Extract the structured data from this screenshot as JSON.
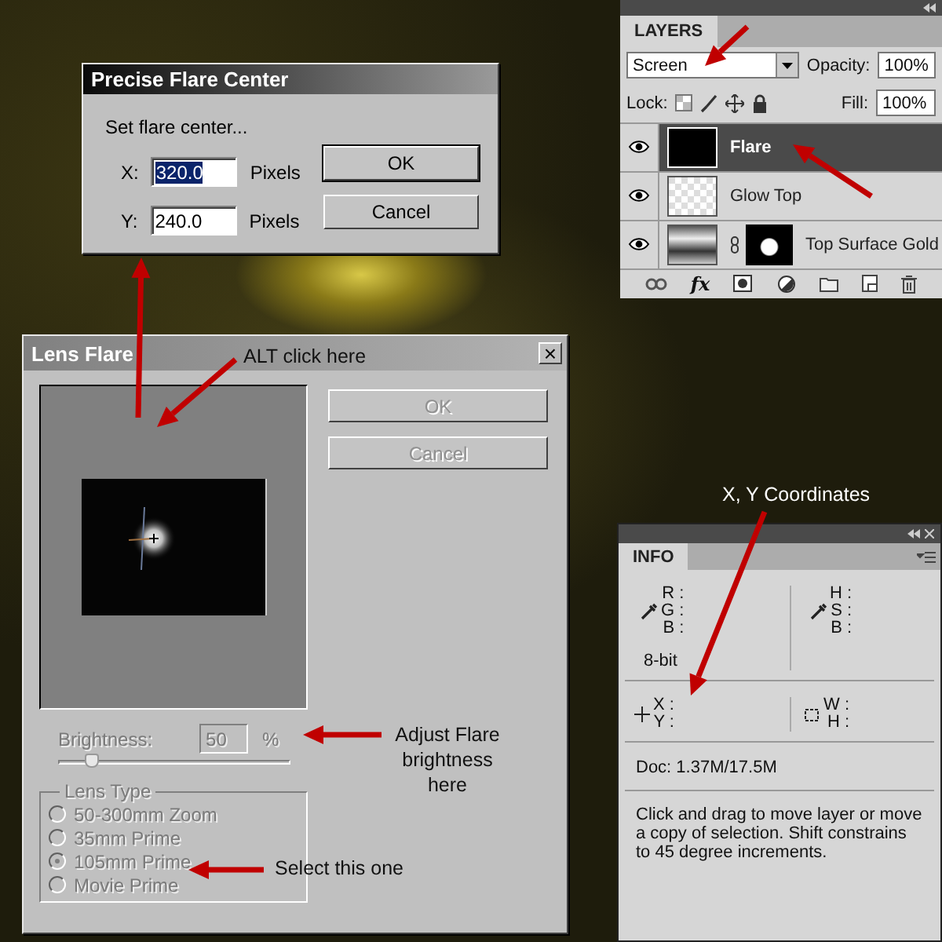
{
  "precise_flare_center": {
    "title": "Precise Flare Center",
    "prompt": "Set flare center...",
    "fields": [
      {
        "label": "X:",
        "value": "320.0",
        "unit": "Pixels",
        "highlighted": true
      },
      {
        "label": "Y:",
        "value": "240.0",
        "unit": "Pixels",
        "highlighted": false
      }
    ],
    "buttons": [
      {
        "label": "OK",
        "default": true
      },
      {
        "label": "Cancel",
        "default": false
      }
    ]
  },
  "lens_flare": {
    "title": "Lens Flare",
    "close": "×",
    "buttons": [
      {
        "label": "OK",
        "disabled": true
      },
      {
        "label": "Cancel",
        "disabled": true
      }
    ],
    "brightness": {
      "label": "Brightness:",
      "value": "50",
      "unit": "%",
      "level": 0.14,
      "disabled": true
    },
    "lens_type": {
      "label": "Lens Type",
      "options": [
        {
          "label": "50-300mm Zoom",
          "selected": false
        },
        {
          "label": "35mm Prime",
          "selected": false
        },
        {
          "label": "105mm Prime",
          "selected": true
        },
        {
          "label": "Movie Prime",
          "selected": false
        }
      ]
    }
  },
  "layers_panel": {
    "tab": "LAYERS",
    "blend_mode": "Screen",
    "opacity_label": "Opacity:",
    "opacity": "100%",
    "lock_label": "Lock:",
    "fill_label": "Fill:",
    "fill": "100%",
    "layers": [
      {
        "name": "Flare",
        "kind": "solid",
        "selected": true,
        "visible": true
      },
      {
        "name": "Glow Top",
        "kind": "transparent",
        "selected": false,
        "visible": true
      },
      {
        "name": "Top Surface Gold",
        "kind": "masked",
        "selected": false,
        "visible": true
      }
    ],
    "style_button": "fx"
  },
  "info_panel": {
    "tab": "INFO",
    "color_left": [
      "R :",
      "G :",
      "B :"
    ],
    "bit_depth": "8-bit",
    "color_right": [
      "H :",
      "S :",
      "B :"
    ],
    "position": [
      "X :",
      "Y :"
    ],
    "size": [
      "W :",
      "H :"
    ],
    "doc": "Doc: 1.37M/17.5M",
    "hint": "Click and drag to move layer or move a copy of selection. Shift constrains to 45 degree increments."
  },
  "annotations": [
    {
      "text": "ALT click here"
    },
    {
      "text": "X, Y Coordinates"
    },
    {
      "text": "Adjust Flare brightness here"
    },
    {
      "text": "Select this one"
    }
  ]
}
